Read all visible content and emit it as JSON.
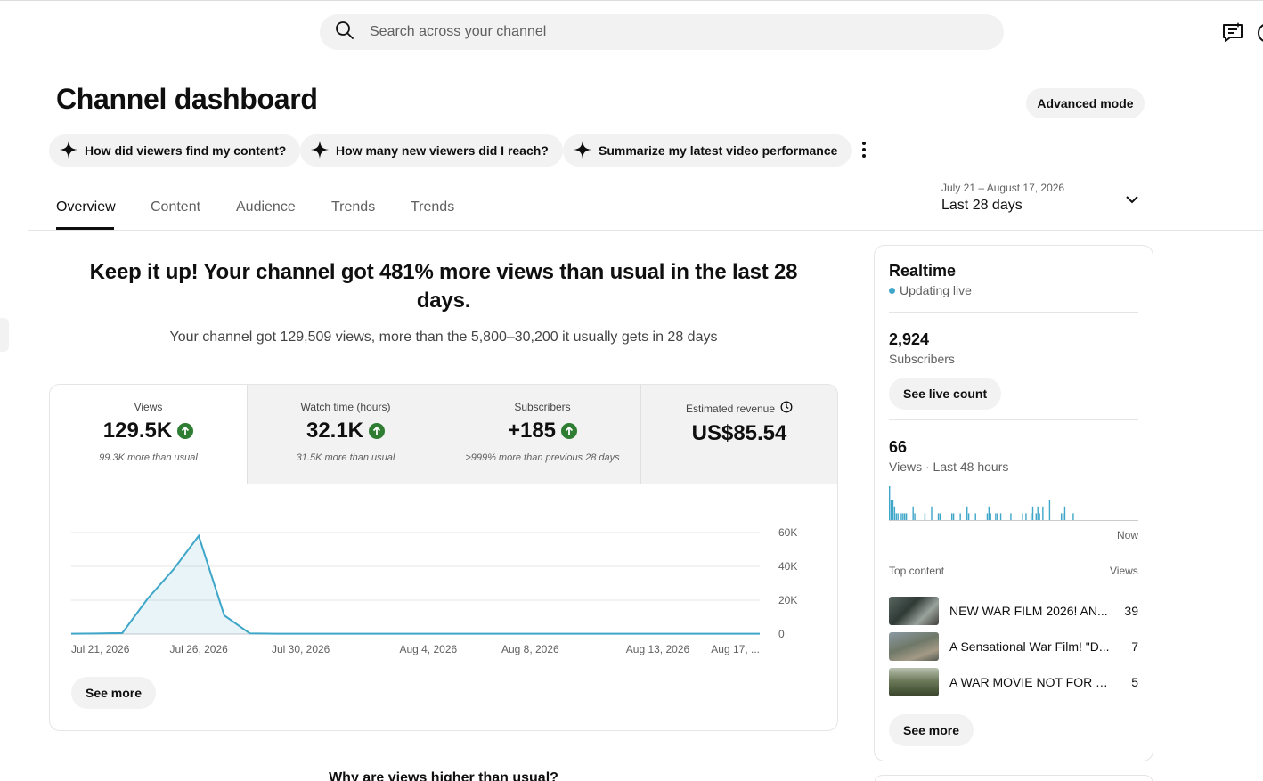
{
  "search": {
    "placeholder": "Search across your channel"
  },
  "header": {
    "title": "Channel dashboard",
    "advanced_mode": "Advanced mode"
  },
  "suggestions": [
    "How did viewers find my content?",
    "How many new viewers did I reach?",
    "Summarize my latest video performance"
  ],
  "tabs": [
    "Overview",
    "Content",
    "Audience",
    "Trends",
    "Trends"
  ],
  "date_range": {
    "dates": "July 21 – August 17, 2026",
    "label": "Last 28 days"
  },
  "summary": {
    "headline": "Keep it up! Your channel got 481% more views than usual in the last 28 days.",
    "subline": "Your channel got 129,509 views, more than the 5,800–30,200 it usually gets in 28 days"
  },
  "metrics": [
    {
      "label": "Views",
      "value": "129.5K",
      "note": "99.3K more than usual"
    },
    {
      "label": "Watch time (hours)",
      "value": "32.1K",
      "note": "31.5K more than usual"
    },
    {
      "label": "Subscribers",
      "value": "+185",
      "note": ">999% more than previous 28 days"
    },
    {
      "label": "Estimated revenue",
      "value": "US$85.54",
      "note": ""
    }
  ],
  "colors": {
    "accent": "#3ea6c8",
    "up": "#2e7d32",
    "chip_bg": "#f2f2f2"
  },
  "chart_data": {
    "type": "area",
    "x": [
      "Jul 21",
      "Jul 22",
      "Jul 23",
      "Jul 24",
      "Jul 25",
      "Jul 26",
      "Jul 27",
      "Jul 28",
      "Jul 29",
      "Jul 30",
      "Jul 31",
      "Aug 1",
      "Aug 2",
      "Aug 3",
      "Aug 4",
      "Aug 5",
      "Aug 6",
      "Aug 7",
      "Aug 8",
      "Aug 9",
      "Aug 10",
      "Aug 11",
      "Aug 12",
      "Aug 13",
      "Aug 14",
      "Aug 15",
      "Aug 16",
      "Aug 17"
    ],
    "series": [
      {
        "values": [
          200,
          300,
          600,
          21000,
          38000,
          58000,
          11000,
          400,
          200,
          200,
          200,
          200,
          200,
          200,
          200,
          200,
          200,
          200,
          200,
          200,
          200,
          200,
          200,
          200,
          200,
          200,
          200,
          200
        ]
      }
    ],
    "xtick_labels": [
      "Jul 21, 2026",
      "Jul 26, 2026",
      "Jul 30, 2026",
      "Aug 4, 2026",
      "Aug 8, 2026",
      "Aug 13, 2026",
      "Aug 17, ..."
    ],
    "xtick_index": [
      0,
      5,
      9,
      14,
      18,
      23,
      27
    ],
    "yticks": [
      "60K",
      "40K",
      "20K",
      "0"
    ],
    "ytick_values": [
      60000,
      40000,
      20000,
      0
    ],
    "ylim": [
      0,
      60000
    ]
  },
  "card_see_more": "See more",
  "why_title": "Why are views higher than usual?",
  "realtime": {
    "title": "Realtime",
    "status": "Updating live",
    "subscribers": "2,924",
    "subscribers_label": "Subscribers",
    "see_live_count": "See live count",
    "views": "66",
    "views_label": "Views · Last 48 hours",
    "now_label": "Now",
    "bars": [
      5,
      3,
      3,
      2,
      1,
      1,
      0,
      1,
      1,
      1,
      1,
      0,
      0,
      0,
      2,
      1,
      0,
      0,
      0,
      0,
      0,
      1,
      0,
      0,
      0,
      2,
      0,
      0,
      0,
      1,
      1,
      0,
      0,
      0,
      0,
      0,
      0,
      1,
      1,
      0,
      0,
      0,
      1,
      0,
      0,
      0,
      2,
      1,
      0,
      0,
      0,
      1,
      0,
      0,
      0,
      0,
      0,
      0,
      1,
      2,
      1,
      0,
      0,
      1,
      1,
      0,
      1,
      0,
      0,
      0,
      0,
      0,
      1,
      0,
      0,
      0,
      0,
      0,
      0,
      1,
      0,
      1,
      0,
      0,
      1,
      2,
      0,
      1,
      2,
      1,
      0,
      2,
      0,
      0,
      0,
      3,
      0,
      0,
      0,
      0,
      0,
      0,
      1,
      1,
      2,
      0,
      0,
      0,
      0,
      1,
      0,
      0,
      0,
      0,
      0,
      0,
      0,
      0,
      0,
      0,
      0,
      0,
      0,
      0,
      0,
      0,
      0,
      0,
      0,
      0,
      0,
      0,
      0,
      0,
      0,
      0,
      0,
      0,
      0,
      0,
      0,
      0,
      0,
      0,
      0,
      0,
      0,
      0
    ],
    "top_content_label": "Top content",
    "views_col": "Views",
    "top_content": [
      {
        "title": "NEW WAR FILM 2026! AN...",
        "views": "39"
      },
      {
        "title": "A Sensational War Film! \"D...",
        "views": "7"
      },
      {
        "title": "A WAR MOVIE NOT FOR TH...",
        "views": "5"
      }
    ],
    "see_more": "See more"
  }
}
